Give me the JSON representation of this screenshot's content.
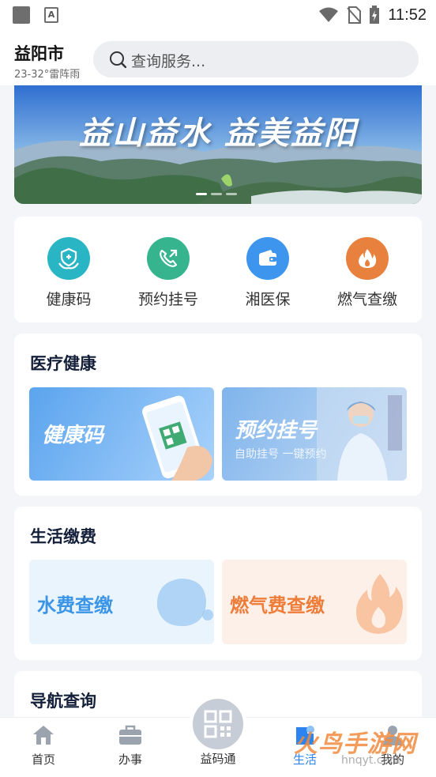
{
  "status_bar": {
    "time": "11:52",
    "icons": [
      "gallery-square-icon",
      "a-notification-icon",
      "wifi-icon",
      "no-sim-icon",
      "battery-charging-icon"
    ]
  },
  "header": {
    "city": "益阳市",
    "weather": "23-32°雷阵雨",
    "search_placeholder": "查询服务..."
  },
  "banner": {
    "slogan": "益山益水 益美益阳",
    "slide_count": 3,
    "active_slide": 1
  },
  "quick_services": [
    {
      "label": "健康码",
      "icon": "health-hands-icon",
      "color": "#2ab5c4"
    },
    {
      "label": "预约挂号",
      "icon": "phone-call-icon",
      "color": "#36b48e"
    },
    {
      "label": "湘医保",
      "icon": "wallet-icon",
      "color": "#3d95ee"
    },
    {
      "label": "燃气查缴",
      "icon": "flame-icon",
      "color": "#e8803e"
    }
  ],
  "medical": {
    "title": "医疗健康",
    "tiles": [
      {
        "title": "健康码",
        "subtitle": ""
      },
      {
        "title": "预约挂号",
        "subtitle": "自助挂号 一键预约"
      }
    ]
  },
  "life": {
    "title": "生活缴费",
    "tiles": [
      {
        "title": "水费查缴",
        "color": "#3b95e6"
      },
      {
        "title": "燃气费查缴",
        "color": "#ef7d3a"
      }
    ]
  },
  "nav_section": {
    "title": "导航查询"
  },
  "bottom_nav": {
    "items": [
      {
        "label": "首页",
        "icon": "home-icon",
        "active": false
      },
      {
        "label": "办事",
        "icon": "briefcase-icon",
        "active": false
      },
      {
        "label": "益码通",
        "icon": "qr-code-icon",
        "active": false
      },
      {
        "label": "生活",
        "icon": "life-icon",
        "active": true
      },
      {
        "label": "我的",
        "icon": "user-icon",
        "active": false
      }
    ]
  },
  "watermark": {
    "text": "火鸟手游网",
    "url_text": "hnqyt.com"
  }
}
